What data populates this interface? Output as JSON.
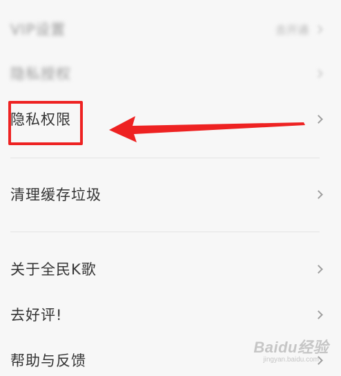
{
  "settings": {
    "rows": [
      {
        "label": "VIP设置",
        "value": "去开通"
      },
      {
        "label": "隐私授权",
        "value": ""
      },
      {
        "label": "隐私权限",
        "value": ""
      },
      {
        "label": "清理缓存垃圾",
        "value": ""
      },
      {
        "label": "关于全民K歌",
        "value": ""
      },
      {
        "label": "去好评!",
        "value": ""
      },
      {
        "label": "帮助与反馈",
        "value": ""
      }
    ]
  },
  "annotation": {
    "box_color": "#ee2222",
    "arrow_color": "#ee2222"
  },
  "watermark": {
    "main": "Baidu经验",
    "sub": "jingyan.baidu.com"
  },
  "colors": {
    "background": "#f7f7f7",
    "text": "#333333",
    "chevron": "#9f9f9f",
    "divider": "#e3e3e3"
  }
}
